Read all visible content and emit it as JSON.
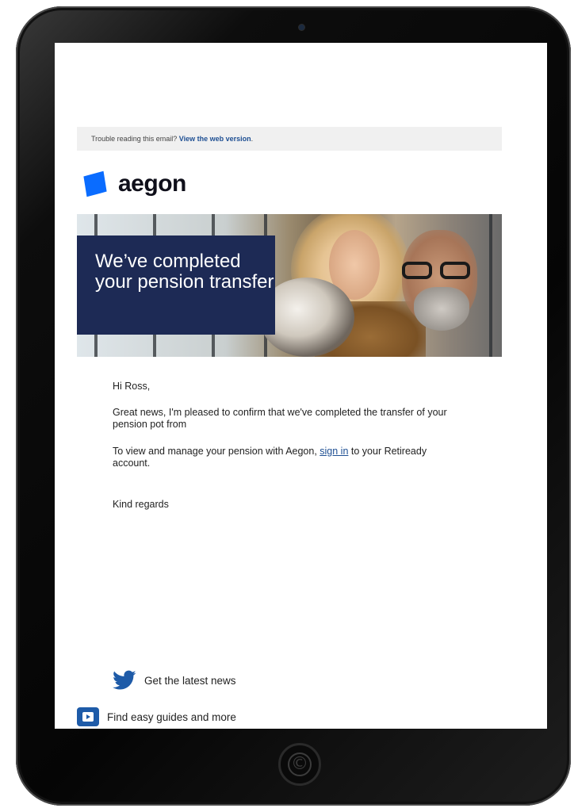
{
  "email": {
    "preheader": {
      "text": "Trouble reading this email? ",
      "link": "View the web version",
      "suffix": "."
    },
    "brand": {
      "name": "aegon",
      "color": "#0a6cff"
    },
    "hero": {
      "title": "We’ve completed your pension transfer",
      "box_color": "#1d2a55"
    },
    "body": {
      "greeting": "Hi Ross,",
      "paragraph_1": "Great news, I'm pleased to confirm that we've completed the transfer of your pension pot from",
      "paragraph_2_prefix": "To view and manage your pension with Aegon, ",
      "paragraph_2_link": "sign in",
      "paragraph_2_suffix": " to your Retiready account.",
      "signoff": "Kind regards"
    },
    "social": {
      "twitter_label": "Get the latest news",
      "youtube_label": "Find easy guides and more",
      "icon_color": "#1e5ba8"
    }
  },
  "device": {
    "home_button_glyph": "©"
  }
}
